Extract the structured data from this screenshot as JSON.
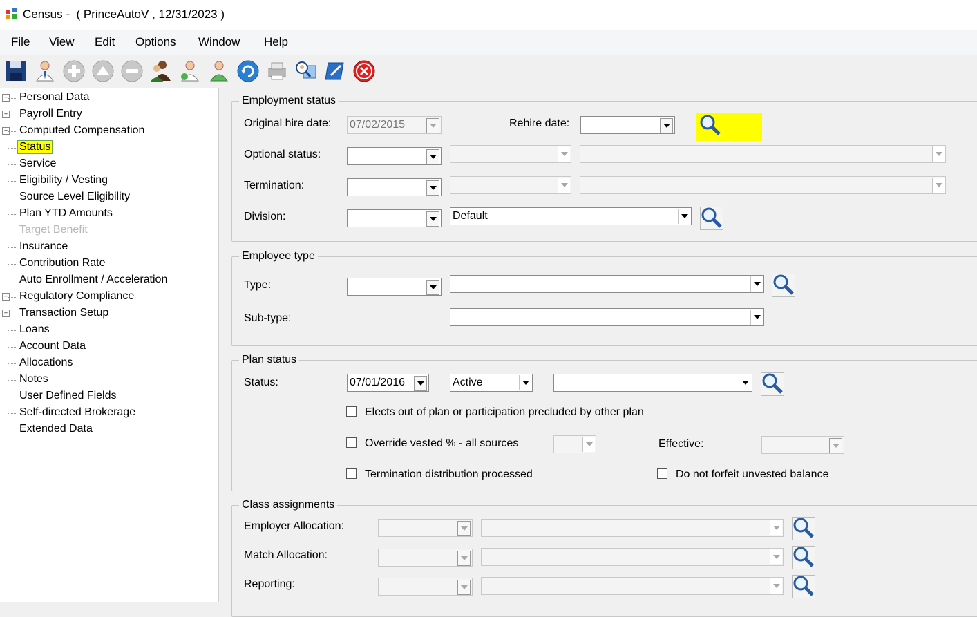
{
  "window": {
    "title": "Census -  ( PrinceAutoV , 12/31/2023 )"
  },
  "menu": [
    "File",
    "View",
    "Edit",
    "Options",
    "Window",
    "Help"
  ],
  "toolbar": [
    "save-icon",
    "person-icon",
    "add-icon",
    "up-icon",
    "remove-icon",
    "group-icon",
    "person-add-icon",
    "person-green-icon",
    "refresh-icon",
    "printer-icon",
    "search-person-icon",
    "edit-icon",
    "close-icon"
  ],
  "tree": [
    {
      "label": "Personal Data",
      "expandable": true
    },
    {
      "label": "Payroll Entry",
      "expandable": true
    },
    {
      "label": "Computed Compensation",
      "expandable": true
    },
    {
      "label": "Status",
      "selected": true
    },
    {
      "label": "Service"
    },
    {
      "label": "Eligibility / Vesting"
    },
    {
      "label": "Source Level Eligibility"
    },
    {
      "label": "Plan YTD Amounts"
    },
    {
      "label": "Target Benefit",
      "disabled": true
    },
    {
      "label": "Insurance"
    },
    {
      "label": "Contribution Rate"
    },
    {
      "label": "Auto Enrollment / Acceleration"
    },
    {
      "label": "Regulatory Compliance",
      "expandable": true
    },
    {
      "label": "Transaction Setup",
      "expandable": true
    },
    {
      "label": "Loans"
    },
    {
      "label": "Account Data"
    },
    {
      "label": "Allocations"
    },
    {
      "label": "Notes"
    },
    {
      "label": "User Defined Fields"
    },
    {
      "label": "Self-directed Brokerage"
    },
    {
      "label": "Extended Data"
    }
  ],
  "employment": {
    "legend": "Employment status",
    "orig_hire_label": "Original hire date:",
    "orig_hire_value": "07/02/2015",
    "rehire_label": "Rehire date:",
    "rehire_value": "",
    "optional_label": "Optional status:",
    "termination_label": "Termination:",
    "division_label": "Division:",
    "division_value": "Default"
  },
  "employee_type": {
    "legend": "Employee type",
    "type_label": "Type:",
    "subtype_label": "Sub-type:"
  },
  "plan_status": {
    "legend": "Plan status",
    "status_label": "Status:",
    "status_date": "07/01/2016",
    "status_value": "Active",
    "elects_out": "Elects out of plan or participation precluded by other plan",
    "override": "Override vested % - all sources",
    "effective_label": "Effective:",
    "term_dist": "Termination distribution processed",
    "no_forfeit": "Do not forfeit unvested balance"
  },
  "class_assignments": {
    "legend": "Class assignments",
    "employer_label": "Employer Allocation:",
    "match_label": "Match Allocation:",
    "reporting_label": "Reporting:"
  },
  "colors": {
    "highlight": "#ffff00",
    "panel_bg": "#f0f0f0"
  }
}
